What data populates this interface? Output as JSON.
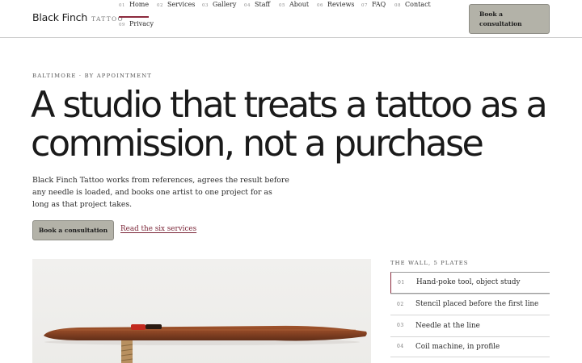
{
  "brand": {
    "name": "Black Finch",
    "tag": "TATTOO"
  },
  "nav": {
    "items": [
      {
        "num": "01",
        "label": "Home",
        "active": true
      },
      {
        "num": "02",
        "label": "Services"
      },
      {
        "num": "03",
        "label": "Gallery"
      },
      {
        "num": "04",
        "label": "Staff"
      },
      {
        "num": "05",
        "label": "About"
      },
      {
        "num": "06",
        "label": "Reviews"
      },
      {
        "num": "07",
        "label": "FAQ"
      },
      {
        "num": "08",
        "label": "Contact"
      },
      {
        "num": "09",
        "label": "Privacy"
      }
    ],
    "cta": "Book a consultation"
  },
  "hero": {
    "eyebrow": "BALTIMORE · BY APPOINTMENT",
    "headline": "A studio that treats a tattoo as a commission, not a purchase",
    "lede": "Black Finch Tattoo works from references, agrees the result before any needle is loaded, and books one artist to one project for as long as that project takes.",
    "primary_button": "Book a consultation",
    "secondary_link": "Read the six services"
  },
  "wall": {
    "label": "THE WALL, 5 PLATES",
    "items": [
      {
        "num": "01",
        "label": "Hand-poke tool, object study",
        "active": true
      },
      {
        "num": "02",
        "label": "Stencil placed before the first line"
      },
      {
        "num": "03",
        "label": "Needle at the line"
      },
      {
        "num": "04",
        "label": "Coil machine, in profile"
      }
    ]
  },
  "colors": {
    "accent": "#8c2a3d",
    "button": "#b3b2a8",
    "text": "#1a1a1a"
  }
}
